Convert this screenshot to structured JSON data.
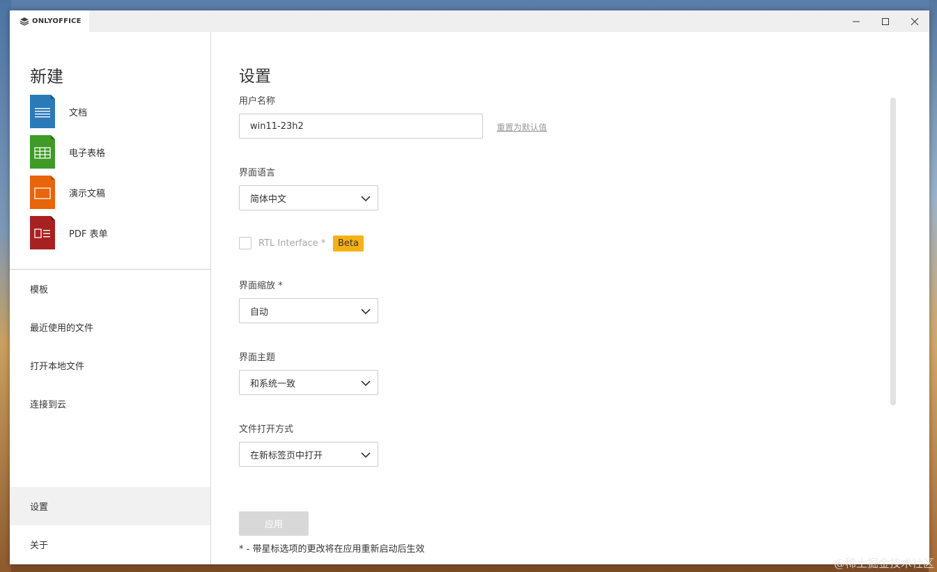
{
  "titlebar": {
    "brand": "ONLYOFFICE"
  },
  "sidebar": {
    "new_title": "新建",
    "new_items": [
      {
        "label": "文档",
        "icon": "document-icon",
        "color": "#2a7ab8"
      },
      {
        "label": "电子表格",
        "icon": "spreadsheet-icon",
        "color": "#3f9a27"
      },
      {
        "label": "演示文稿",
        "icon": "presentation-icon",
        "color": "#e8650a"
      },
      {
        "label": "PDF 表单",
        "icon": "pdf-form-icon",
        "color": "#a82121"
      }
    ],
    "nav": [
      "模板",
      "最近使用的文件",
      "打开本地文件",
      "连接到云",
      "设置",
      "关于"
    ],
    "active_nav": "设置"
  },
  "settings": {
    "title": "设置",
    "username_label": "用户名称",
    "username_value": "win11-23h2",
    "reset_label": "重置为默认值",
    "language_label": "界面语言",
    "language_value": "简体中文",
    "rtl_label": "RTL Interface *",
    "rtl_checked": false,
    "beta_badge": "Beta",
    "scale_label": "界面缩放 *",
    "scale_value": "自动",
    "theme_label": "界面主题",
    "theme_value": "和系统一致",
    "open_mode_label": "文件打开方式",
    "open_mode_value": "在新标签页中打开",
    "apply_label": "应用",
    "footnote": "* - 带星标选项的更改将在应用重新启动后生效"
  },
  "watermark": "@稀土掘金技术社区",
  "colors": {
    "beta": "#f6b214",
    "active_nav_bg": "#f1f1f1",
    "apply_disabled": "#d8d8d8"
  }
}
